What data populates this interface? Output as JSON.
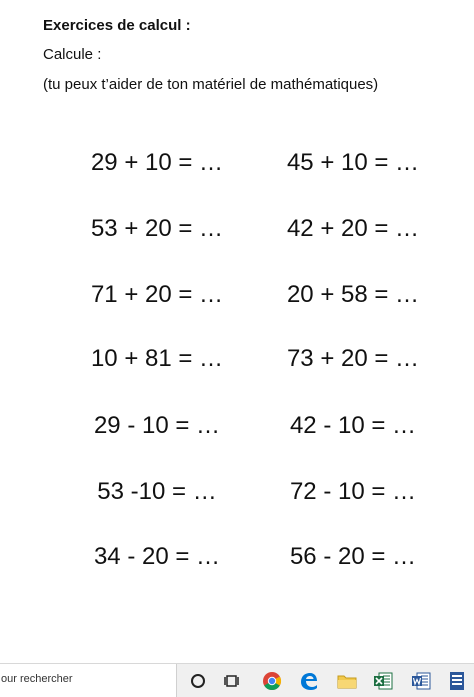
{
  "document": {
    "title": "Exercices de calcul :",
    "subtitle": "Calcule :",
    "hint": "(tu peux t’aider de ton matériel de mathématiques)",
    "exercises": [
      "29 + 10 = …",
      "45 + 10 = …",
      "53 + 20 = …",
      "42 + 20 = …",
      "71 + 20 = …",
      "20 + 58 = …",
      "10 + 81 = …",
      "73 + 20 = …",
      "29 - 10 = …",
      "42 - 10 = …",
      "53 -10 = …",
      "72 - 10 = …",
      "34 - 20 = …",
      "56 - 20 = …"
    ]
  },
  "taskbar": {
    "search_text": "our rechercher",
    "icons": [
      "cortana-circle-icon",
      "task-view-icon",
      "chrome-icon",
      "edge-icon",
      "file-explorer-icon",
      "excel-icon",
      "word-icon",
      "word-document-icon"
    ],
    "colors": {
      "chrome_red": "#db4437",
      "chrome_yellow": "#f4b400",
      "chrome_green": "#0f9d58",
      "chrome_blue": "#4285f4",
      "edge_blue": "#0078d7",
      "explorer_yellow": "#f2c94c",
      "excel_green": "#1d6f42",
      "word_blue": "#2b579a"
    }
  }
}
